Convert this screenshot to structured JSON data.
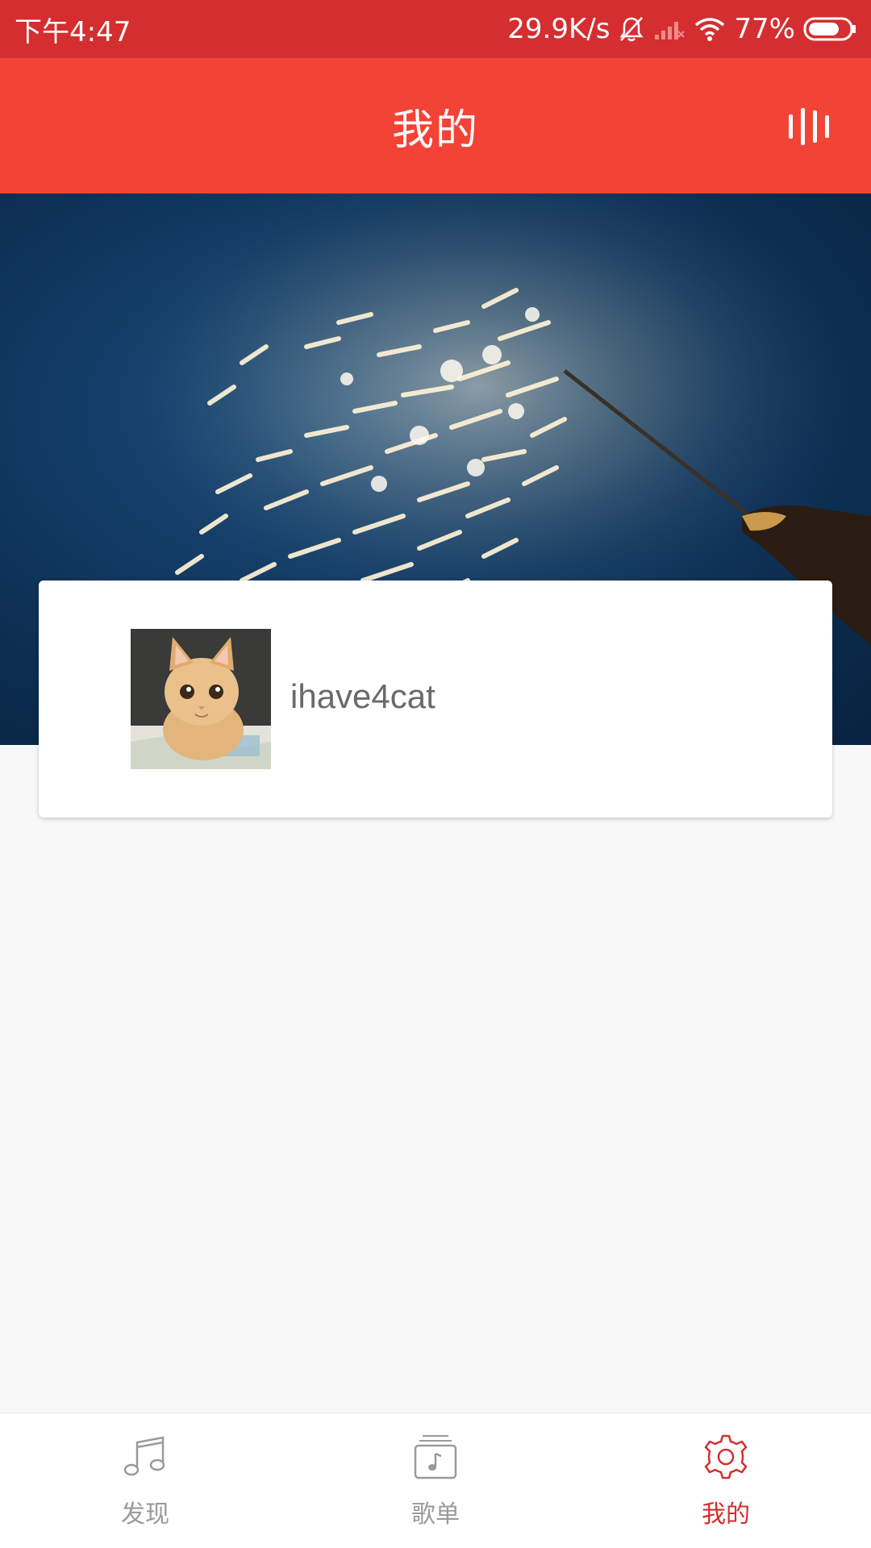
{
  "status_bar": {
    "time": "下午4:47",
    "net_speed": "29.9K/s",
    "battery": "77%",
    "battery_level": 0.77,
    "icons": [
      "bell-muted-icon",
      "signal-icon",
      "wifi-icon",
      "battery-icon"
    ]
  },
  "header": {
    "title": "我的",
    "action_icon": "now-playing-icon"
  },
  "profile": {
    "username": "ihave4cat",
    "avatar_icon": "cat-avatar"
  },
  "bottom_nav": {
    "items": [
      {
        "label": "发现",
        "icon": "music-note-icon",
        "active": false
      },
      {
        "label": "歌单",
        "icon": "playlist-icon",
        "active": false
      },
      {
        "label": "我的",
        "icon": "gear-icon",
        "active": true
      }
    ]
  },
  "colors": {
    "status_bar": "#d42e30",
    "header": "#f34336",
    "active": "#d42e30",
    "inactive": "#9a9a9a"
  }
}
